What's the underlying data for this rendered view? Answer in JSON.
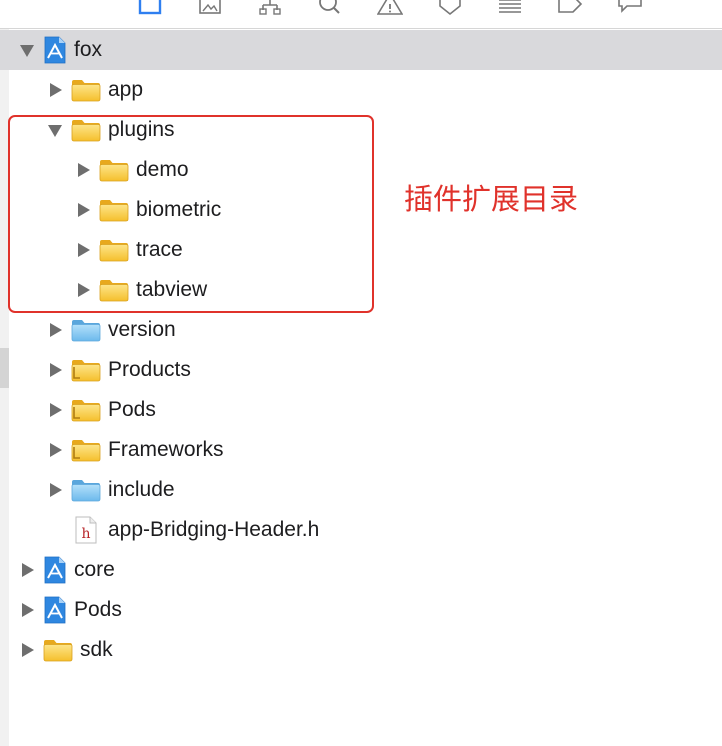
{
  "toolbar": {
    "icons": [
      "folder-icon",
      "image-icon",
      "hierarchy-icon",
      "search-icon",
      "warning-icon",
      "tag-icon",
      "list-icon",
      "tag-outline-icon",
      "comment-icon"
    ]
  },
  "tree": {
    "root_fox": {
      "label": "fox",
      "icon": "xcode-project-icon",
      "expanded": true
    },
    "app": {
      "label": "app",
      "icon": "folder-yellow-icon",
      "expanded": false
    },
    "plugins": {
      "label": "plugins",
      "icon": "folder-yellow-icon",
      "expanded": true
    },
    "demo": {
      "label": "demo",
      "icon": "folder-yellow-icon",
      "expanded": false
    },
    "biometric": {
      "label": "biometric",
      "icon": "folder-yellow-icon",
      "expanded": false
    },
    "trace": {
      "label": "trace",
      "icon": "folder-yellow-icon",
      "expanded": false
    },
    "tabview": {
      "label": "tabview",
      "icon": "folder-yellow-icon",
      "expanded": false
    },
    "version": {
      "label": "version",
      "icon": "folder-blue-icon",
      "expanded": false
    },
    "products": {
      "label": "Products",
      "icon": "folder-group-icon",
      "expanded": false
    },
    "pods_group": {
      "label": "Pods",
      "icon": "folder-group-icon",
      "expanded": false
    },
    "frameworks": {
      "label": "Frameworks",
      "icon": "folder-group-icon",
      "expanded": false
    },
    "include": {
      "label": "include",
      "icon": "folder-blue-icon",
      "expanded": false
    },
    "bridging_header": {
      "label": "app-Bridging-Header.h",
      "icon": "header-file-icon"
    },
    "core": {
      "label": "core",
      "icon": "xcode-project-icon",
      "expanded": false
    },
    "pods_project": {
      "label": "Pods",
      "icon": "xcode-project-icon",
      "expanded": false
    },
    "sdk": {
      "label": "sdk",
      "icon": "folder-yellow-icon",
      "expanded": false
    }
  },
  "annotation": {
    "text": "插件扩展目录",
    "color": "#e0322b"
  },
  "colors": {
    "folder_yellow": "#f7c948",
    "folder_blue": "#7cc3f0",
    "selection": "#d9d9dc",
    "text": "#1d1d1f",
    "triangle": "#6e6e6e"
  }
}
